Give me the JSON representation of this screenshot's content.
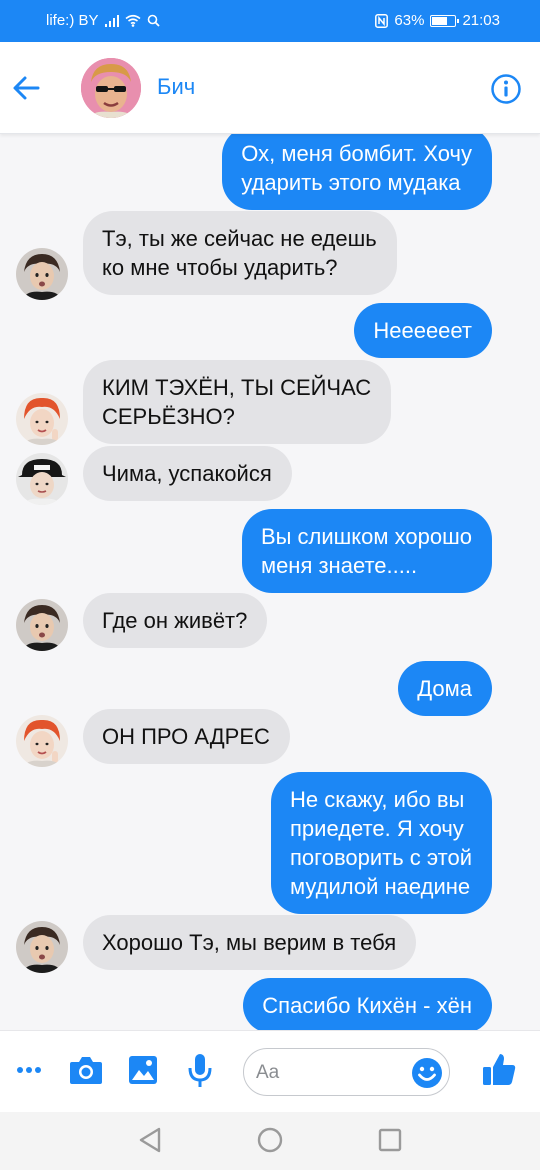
{
  "status_bar": {
    "carrier": "life:) BY",
    "battery": "63%",
    "time": "21:03"
  },
  "header": {
    "contact_name": "Бич"
  },
  "messages": [
    {
      "side": "out",
      "text": "Ох, меня бомбит. Хочу\nударить этого мудака"
    },
    {
      "side": "in",
      "avatar": "avatar-tae",
      "text": "Тэ, ты же сейчас не едешь\nко мне чтобы ударить?"
    },
    {
      "side": "out",
      "text": "Неееееет"
    },
    {
      "side": "in",
      "avatar": "avatar-jimin",
      "text": "КИМ ТЭХЁН, ТЫ СЕЙЧАС\nСЕРЬЁЗНО?"
    },
    {
      "side": "in",
      "avatar": "avatar-cap",
      "text": "Чима, успакойся"
    },
    {
      "side": "out",
      "text": "Вы слишком хорошо\nменя знаете....."
    },
    {
      "side": "in",
      "avatar": "avatar-tae",
      "text": "Где он живёт?"
    },
    {
      "side": "out",
      "text": "Дома"
    },
    {
      "side": "in",
      "avatar": "avatar-jimin",
      "text": "ОН ПРО АДРЕС"
    },
    {
      "side": "out",
      "text": "Не скажу, ибо вы\nприедете. Я хочу\nпоговорить с этой\nмудилой наедине"
    },
    {
      "side": "in",
      "avatar": "avatar-tae",
      "text": "Хорошо Тэ, мы верим в тебя"
    },
    {
      "side": "out",
      "text": "Спасибо Кихён - хён"
    }
  ],
  "composer": {
    "placeholder": "Aa"
  },
  "colors": {
    "accent": "#1c87f5",
    "incoming_bubble": "#e3e3e6",
    "background": "#f6f6f8"
  },
  "icons": [
    "back-arrow-icon",
    "info-icon",
    "more-icon",
    "camera-icon",
    "gallery-icon",
    "microphone-icon",
    "emoji-icon",
    "like-icon",
    "nav-back-icon",
    "nav-home-icon",
    "nav-recents-icon"
  ]
}
